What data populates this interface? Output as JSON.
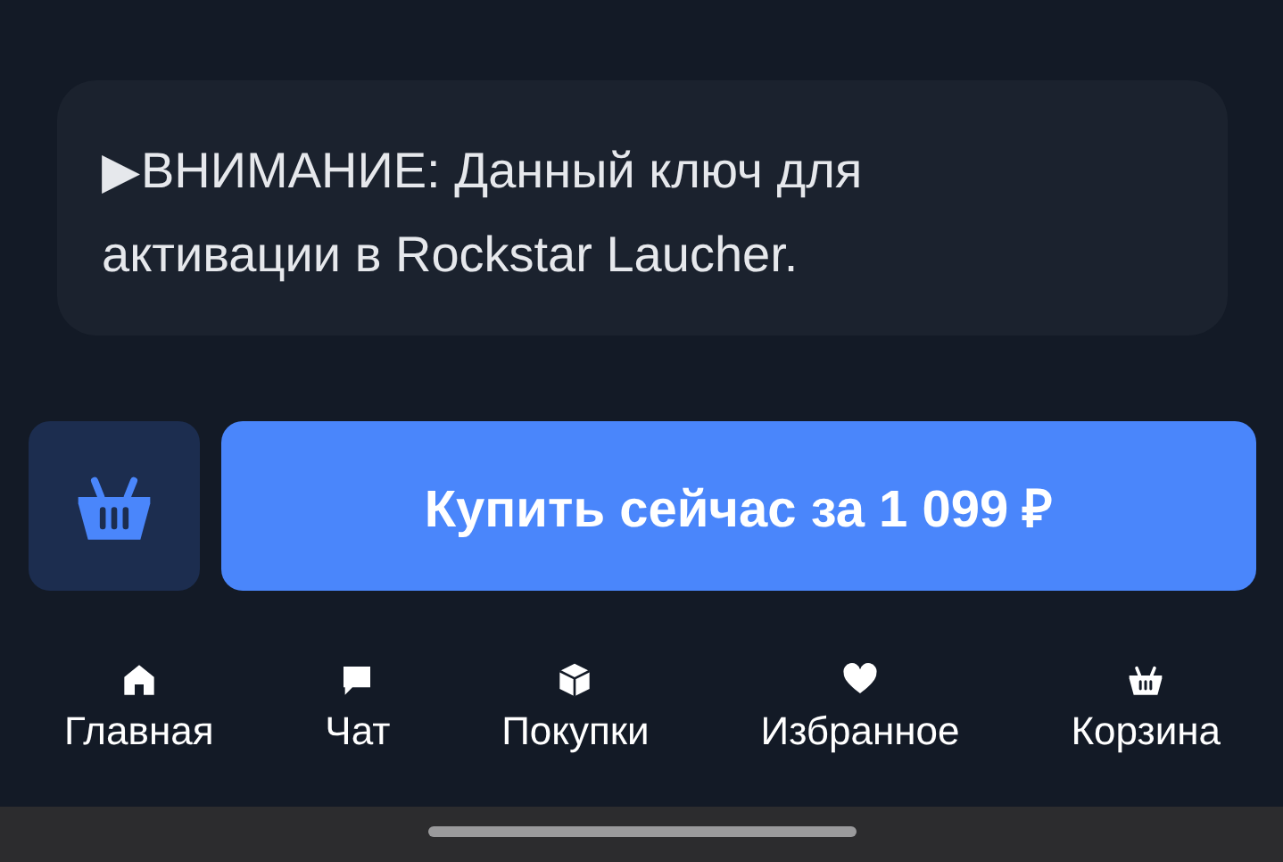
{
  "notice": {
    "text": "▶ВНИМАНИЕ: Данный ключ для активации в Rockstar Laucher."
  },
  "actions": {
    "cart_button": {
      "kind": "basket"
    },
    "buy_button": {
      "label": "Купить сейчас за 1 099 ₽"
    }
  },
  "nav": [
    {
      "kind": "home",
      "label": "Главная"
    },
    {
      "kind": "chat",
      "label": "Чат"
    },
    {
      "kind": "box",
      "label": "Покупки"
    },
    {
      "kind": "heart",
      "label": "Избранное"
    },
    {
      "kind": "basket",
      "label": "Корзина"
    }
  ]
}
